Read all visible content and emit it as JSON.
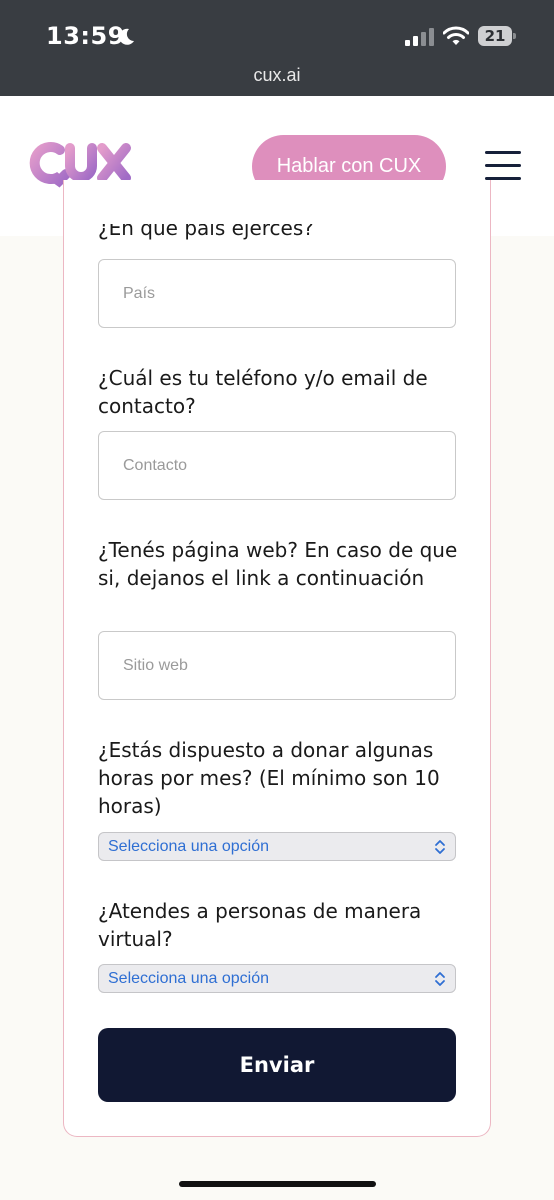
{
  "status_bar": {
    "time": "13:59",
    "battery": "21",
    "url": "cux.ai",
    "icons": [
      "moon-icon",
      "signal-icon",
      "wifi-icon",
      "battery-icon"
    ]
  },
  "header": {
    "logo_text": "CUX",
    "cta_label": "Hablar con CUX",
    "menu_icon": "hamburger-icon"
  },
  "form": {
    "q_country": "¿En qué país ejerces?",
    "country_placeholder": "País",
    "q_contact": "¿Cuál es tu teléfono y/o email de contacto?",
    "contact_placeholder": "Contacto",
    "q_website": "¿Tenés página web? En caso de que si, dejanos el link a continuación",
    "website_placeholder": "Sitio web",
    "q_donate": "¿Estás dispuesto a donar algunas horas por mes? (El mínimo son 10 horas)",
    "donate_select": "Selecciona una opción",
    "q_virtual": "¿Atendes a personas de manera virtual?",
    "virtual_select": "Selecciona una opción",
    "submit_label": "Enviar"
  },
  "colors": {
    "accent_pink": "#de8fbd",
    "navy": "#111833",
    "select_text": "#2f6fd3"
  }
}
